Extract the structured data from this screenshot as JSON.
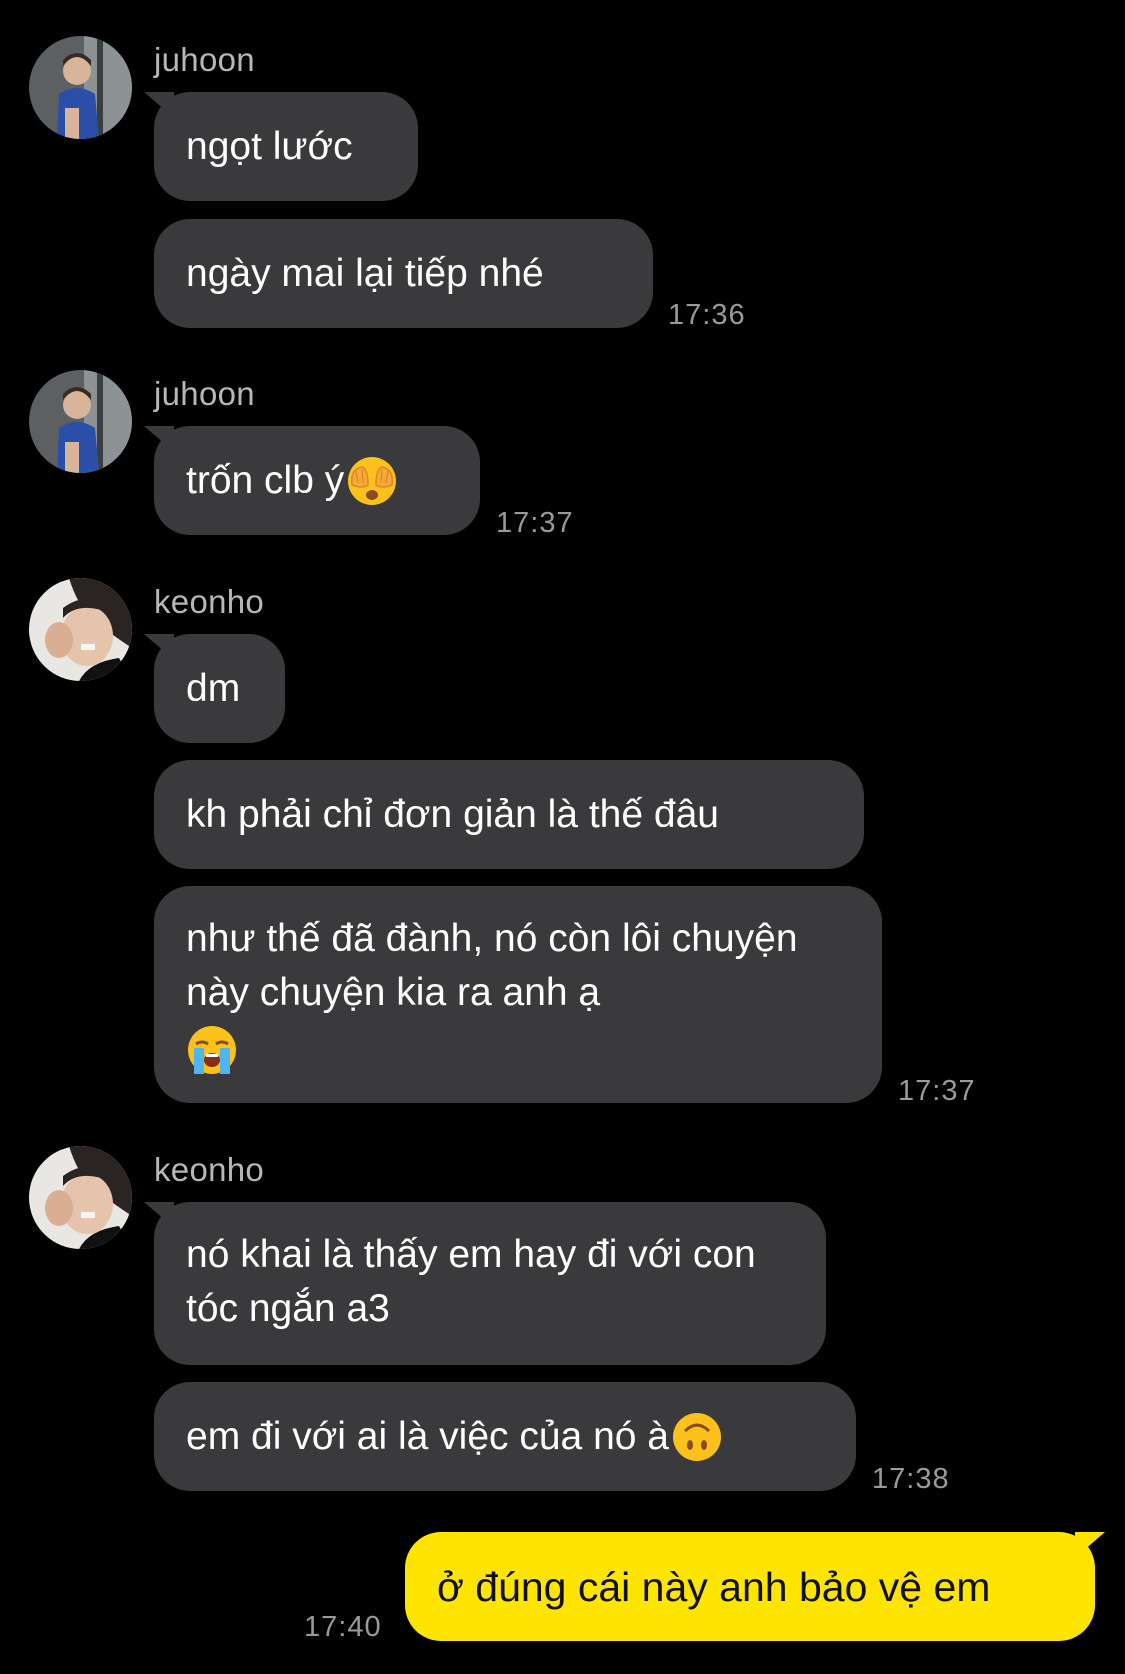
{
  "colors": {
    "background": "#000000",
    "incoming_bubble": "#3a3a3c",
    "outgoing_bubble": "#fee500",
    "sender_name": "#b7b7b7",
    "timestamp": "#9a9a9a"
  },
  "groups": [
    {
      "sender": "juhoon",
      "avatar_icon": "profile-photo",
      "messages": [
        "ngọt lước",
        "ngày mai lại tiếp nhé"
      ],
      "time": "17:36"
    },
    {
      "sender": "juhoon",
      "avatar_icon": "profile-photo",
      "messages": [
        "trốn clb ý"
      ],
      "emoji": "face-with-hands-over-eyes",
      "time": "17:37"
    },
    {
      "sender": "keonho",
      "avatar_icon": "profile-photo",
      "messages": [
        "dm",
        "kh phải chỉ đơn giản là thế đâu",
        "như thế đã đành, nó còn lôi chuyện này chuyện kia ra anh ạ"
      ],
      "emoji": "loudly-crying-face",
      "time": "17:37"
    },
    {
      "sender": "keonho",
      "avatar_icon": "profile-photo",
      "messages": [
        "nó khai là thấy em hay đi với con tóc ngắn a3",
        "em đi với ai là việc của nó à"
      ],
      "emoji": "upside-down-face",
      "time": "17:38"
    }
  ],
  "outgoing": {
    "text": "ở đúng cái này anh bảo vệ em",
    "time": "17:40"
  }
}
